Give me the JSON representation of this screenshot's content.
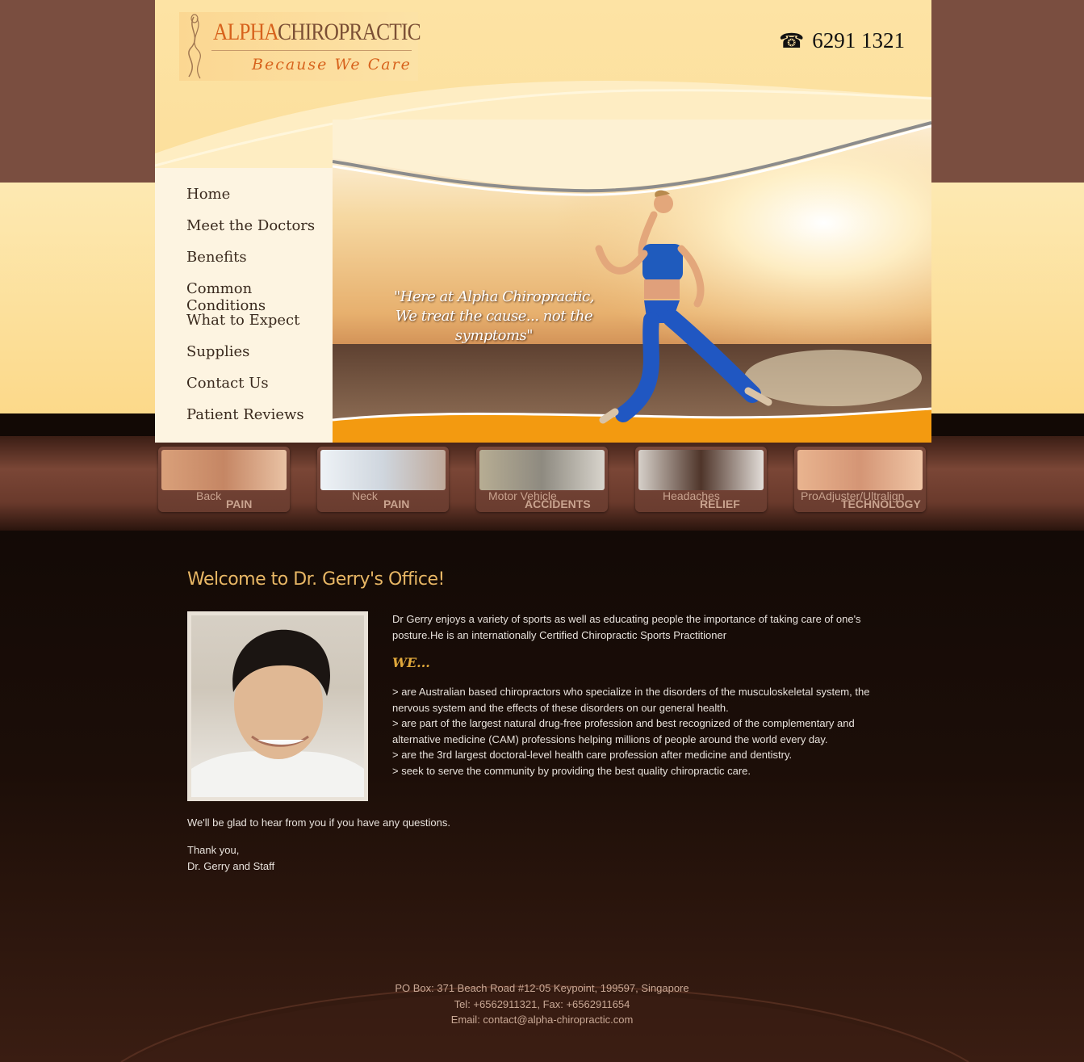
{
  "brand": {
    "name_part1": "ALPHA",
    "name_part2": "CHIROPRACTIC",
    "tagline": "Because We Care",
    "phone": "6291 1321",
    "phone_icon": "telephone-icon"
  },
  "nav": {
    "items": [
      {
        "label": "Home"
      },
      {
        "label": "Meet the Doctors"
      },
      {
        "label": "Benefits"
      },
      {
        "label": "Common Conditions"
      },
      {
        "label": "What to Expect"
      },
      {
        "label": "Supplies"
      },
      {
        "label": "Contact Us"
      },
      {
        "label": "Patient Reviews"
      }
    ]
  },
  "hero": {
    "quote_line1": "\"Here at Alpha Chiropractic,",
    "quote_line2": "We treat the cause... not the symptoms\""
  },
  "tiles": [
    {
      "line1": "Back",
      "line2": "PAIN"
    },
    {
      "line1": "Neck",
      "line2": "PAIN"
    },
    {
      "line1": "Motor Vehicle",
      "line2": "ACCIDENTS"
    },
    {
      "line1": "Headaches",
      "line2": "RELIEF"
    },
    {
      "line1": "ProAdjuster/Ultralign",
      "line2": "TECHNOLOGY"
    }
  ],
  "content": {
    "title": "Welcome to Dr. Gerry's Office!",
    "intro": "Dr Gerry enjoys a variety of sports as well as educating people the importance of taking care of one's posture.He is an internationally Certified Chiropractic Sports Practitioner",
    "we_heading": "WE...",
    "we_items": [
      "> are Australian based chiropractors who specialize in the disorders of the musculoskeletal system, the nervous system and the effects of these disorders on our general health.",
      "> are part of the largest natural drug-free profession and best recognized of the complementary and alternative medicine (CAM) professions helping millions of people around the world every day.",
      "> are the 3rd largest doctoral-level health care profession after medicine and dentistry.",
      "> seek to serve the community by providing the best quality chiropractic care."
    ],
    "glad": "We'll be glad to hear from you if you have any questions.",
    "thanks": "Thank you,",
    "signature": "Dr. Gerry and Staff"
  },
  "footer": {
    "address": "PO Box: 371 Beach Road #12-05 Keypoint, 199597, Singapore",
    "phone_fax": "Tel: +6562911321, Fax: +6562911654",
    "email": "Email: contact@alpha-chiropractic.com"
  },
  "colors": {
    "accent": "#e8b765",
    "brand_orange": "#d7621c",
    "nav_bg": "#fdf4e1",
    "page_dark": "#1a0d08"
  }
}
